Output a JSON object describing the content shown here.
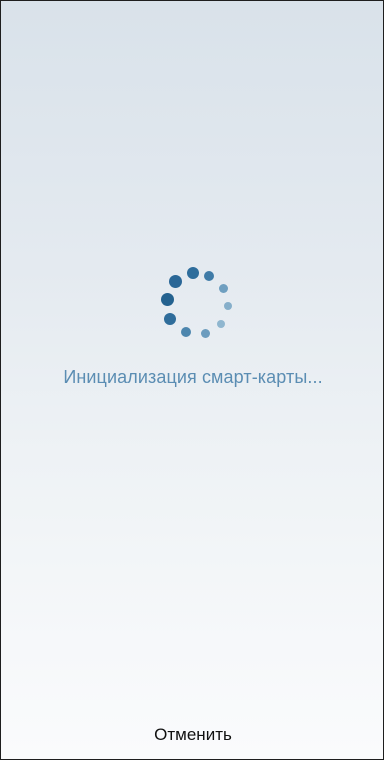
{
  "status_text": "Инициализация смарт-карты...",
  "cancel_label": "Отменить",
  "spinner_icon": "loading-dots-icon",
  "colors": {
    "status_text": "#5b8db3",
    "spinner_dark": "#2a6797",
    "spinner_light": "#8fb6cf"
  }
}
